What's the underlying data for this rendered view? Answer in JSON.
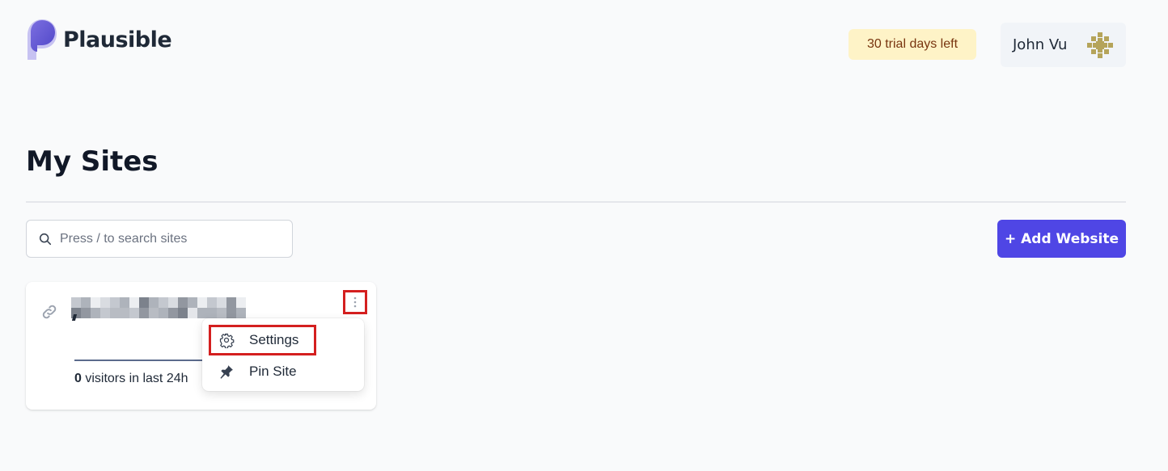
{
  "header": {
    "brand": "Plausible",
    "trial_badge": "30 trial days left",
    "user_name": "John Vu"
  },
  "page": {
    "title": "My Sites"
  },
  "search": {
    "placeholder": "Press / to search sites"
  },
  "actions": {
    "add_website": "+ Add Website"
  },
  "site_card": {
    "visitor_count": "0",
    "visitor_suffix": " visitors in last 24h"
  },
  "menu": {
    "items": [
      {
        "label": "Settings",
        "icon": "gear-icon"
      },
      {
        "label": "Pin Site",
        "icon": "pin-icon"
      }
    ]
  },
  "colors": {
    "accent": "#4f46e5",
    "trial_bg": "#fef3c7",
    "highlight": "#d41f1f"
  }
}
